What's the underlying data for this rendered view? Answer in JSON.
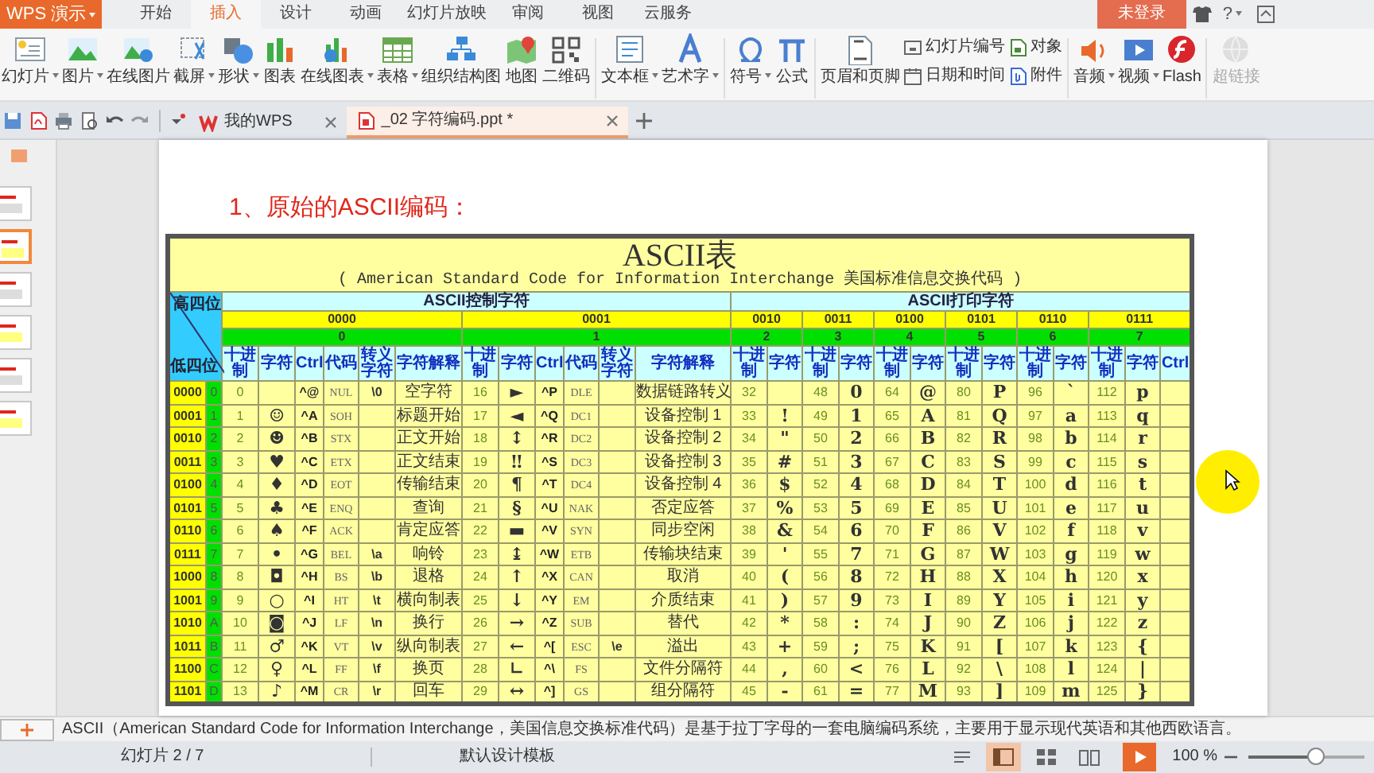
{
  "app_button": {
    "label": "WPS 演示"
  },
  "menu_tabs": [
    {
      "label": "开始",
      "selected": false
    },
    {
      "label": "插入",
      "selected": true
    },
    {
      "label": "设计",
      "selected": false
    },
    {
      "label": "动画",
      "selected": false
    },
    {
      "label": "幻灯片放映",
      "selected": false
    },
    {
      "label": "审阅",
      "selected": false
    },
    {
      "label": "视图",
      "selected": false
    },
    {
      "label": "云服务",
      "selected": false
    }
  ],
  "login_button": {
    "label": "未登录"
  },
  "help_button": {
    "label": "?"
  },
  "ribbon_groups": [
    [
      {
        "label": "幻灯片",
        "dropdown": true
      },
      {
        "label": "图片",
        "dropdown": true
      },
      {
        "label": "在线图片",
        "dropdown": false
      },
      {
        "label": "截屏",
        "dropdown": true
      },
      {
        "label": "形状",
        "dropdown": true
      },
      {
        "label": "图表",
        "dropdown": false
      },
      {
        "label": "在线图表",
        "dropdown": true
      },
      {
        "label": "表格",
        "dropdown": true
      },
      {
        "label": "组织结构图",
        "dropdown": false
      },
      {
        "label": "地图",
        "dropdown": false
      },
      {
        "label": "二维码",
        "dropdown": false
      }
    ],
    [
      {
        "label": "文本框",
        "dropdown": true
      },
      {
        "label": "艺术字",
        "dropdown": true
      }
    ],
    [
      {
        "label": "符号",
        "dropdown": true
      },
      {
        "label": "公式",
        "dropdown": false
      }
    ],
    [
      {
        "label": "页眉和页脚",
        "dropdown": false
      },
      {
        "kind": "stack",
        "items": [
          {
            "label": "幻灯片编号"
          },
          {
            "label": "日期和时间"
          }
        ]
      },
      {
        "kind": "stack",
        "items": [
          {
            "label": "对象"
          },
          {
            "label": "附件"
          }
        ]
      }
    ],
    [
      {
        "label": "音频",
        "dropdown": true
      },
      {
        "label": "视频",
        "dropdown": true
      },
      {
        "label": "Flash",
        "dropdown": false
      }
    ],
    [
      {
        "label": "超链接",
        "dropdown": false,
        "disabled": true
      }
    ]
  ],
  "doc_tabs": [
    {
      "label": "我的WPS",
      "selected": false
    },
    {
      "label": "_02 字符编码.ppt *",
      "selected": true
    }
  ],
  "thumbnails": [
    {
      "selected": false
    },
    {
      "selected": true
    },
    {
      "selected": false
    },
    {
      "selected": false
    },
    {
      "selected": false
    },
    {
      "selected": false
    }
  ],
  "slide": {
    "heading": "1、原始的ASCII编码：",
    "ascii_table": {
      "title": "ASCII表",
      "subtitle": "( American Standard Code for Information Interchange  美国标准信息交换代码 )",
      "corner_top": "高四位",
      "corner_bottom": "低四位",
      "sections": [
        {
          "label": "ASCII控制字符",
          "groups": [
            {
              "binary": "0000",
              "hex": "0",
              "columns": [
                "十进制",
                "字符",
                "Ctrl",
                "代码",
                "转义字符",
                "字符解释"
              ]
            },
            {
              "binary": "0001",
              "hex": "1",
              "columns": [
                "十进制",
                "字符",
                "Ctrl",
                "代码",
                "转义字符",
                "字符解释"
              ]
            }
          ]
        },
        {
          "label": "ASCII打印字符",
          "groups": [
            {
              "binary": "0010",
              "hex": "2",
              "columns": [
                "十进制",
                "字符"
              ]
            },
            {
              "binary": "0011",
              "hex": "3",
              "columns": [
                "十进制",
                "字符"
              ]
            },
            {
              "binary": "0100",
              "hex": "4",
              "columns": [
                "十进制",
                "字符"
              ]
            },
            {
              "binary": "0101",
              "hex": "5",
              "columns": [
                "十进制",
                "字符"
              ]
            },
            {
              "binary": "0110",
              "hex": "6",
              "columns": [
                "十进制",
                "字符"
              ]
            },
            {
              "binary": "0111",
              "hex": "7",
              "columns": [
                "十进制",
                "字符",
                "Ctrl"
              ]
            }
          ]
        }
      ],
      "rows": [
        {
          "binary": "0000",
          "hex": "0",
          "cells": [
            "0",
            null,
            "^@",
            "NUL",
            "\\0",
            "空字符",
            "16",
            "►",
            "^P",
            "DLE",
            null,
            "数据链路转义",
            "32",
            null,
            "48",
            "0",
            "64",
            "@",
            "80",
            "P",
            "96",
            "`",
            "112",
            "p",
            null
          ]
        },
        {
          "binary": "0001",
          "hex": "1",
          "cells": [
            "1",
            "☺",
            "^A",
            "SOH",
            null,
            "标题开始",
            "17",
            "◄",
            "^Q",
            "DC1",
            null,
            "设备控制 1",
            "33",
            "!",
            "49",
            "1",
            "65",
            "A",
            "81",
            "Q",
            "97",
            "a",
            "113",
            "q",
            null
          ]
        },
        {
          "binary": "0010",
          "hex": "2",
          "cells": [
            "2",
            "☻",
            "^B",
            "STX",
            null,
            "正文开始",
            "18",
            "↕",
            "^R",
            "DC2",
            null,
            "设备控制 2",
            "34",
            "\"",
            "50",
            "2",
            "66",
            "B",
            "82",
            "R",
            "98",
            "b",
            "114",
            "r",
            null
          ]
        },
        {
          "binary": "0011",
          "hex": "3",
          "cells": [
            "3",
            "♥",
            "^C",
            "ETX",
            null,
            "正文结束",
            "19",
            "‼",
            "^S",
            "DC3",
            null,
            "设备控制 3",
            "35",
            "#",
            "51",
            "3",
            "67",
            "C",
            "83",
            "S",
            "99",
            "c",
            "115",
            "s",
            null
          ]
        },
        {
          "binary": "0100",
          "hex": "4",
          "cells": [
            "4",
            "♦",
            "^D",
            "EOT",
            null,
            "传输结束",
            "20",
            "¶",
            "^T",
            "DC4",
            null,
            "设备控制 4",
            "36",
            "$",
            "52",
            "4",
            "68",
            "D",
            "84",
            "T",
            "100",
            "d",
            "116",
            "t",
            null
          ]
        },
        {
          "binary": "0101",
          "hex": "5",
          "cells": [
            "5",
            "♣",
            "^E",
            "ENQ",
            null,
            "查询",
            "21",
            "§",
            "^U",
            "NAK",
            null,
            "否定应答",
            "37",
            "%",
            "53",
            "5",
            "69",
            "E",
            "85",
            "U",
            "101",
            "e",
            "117",
            "u",
            null
          ]
        },
        {
          "binary": "0110",
          "hex": "6",
          "cells": [
            "6",
            "♠",
            "^F",
            "ACK",
            null,
            "肯定应答",
            "22",
            "▬",
            "^V",
            "SYN",
            null,
            "同步空闲",
            "38",
            "&",
            "54",
            "6",
            "70",
            "F",
            "86",
            "V",
            "102",
            "f",
            "118",
            "v",
            null
          ]
        },
        {
          "binary": "0111",
          "hex": "7",
          "cells": [
            "7",
            "•",
            "^G",
            "BEL",
            "\\a",
            "响铃",
            "23",
            "↨",
            "^W",
            "ETB",
            null,
            "传输块结束",
            "39",
            "'",
            "55",
            "7",
            "71",
            "G",
            "87",
            "W",
            "103",
            "g",
            "119",
            "w",
            null
          ]
        },
        {
          "binary": "1000",
          "hex": "8",
          "cells": [
            "8",
            "◘",
            "^H",
            "BS",
            "\\b",
            "退格",
            "24",
            "↑",
            "^X",
            "CAN",
            null,
            "取消",
            "40",
            "(",
            "56",
            "8",
            "72",
            "H",
            "88",
            "X",
            "104",
            "h",
            "120",
            "x",
            null
          ]
        },
        {
          "binary": "1001",
          "hex": "9",
          "cells": [
            "9",
            "○",
            "^I",
            "HT",
            "\\t",
            "横向制表",
            "25",
            "↓",
            "^Y",
            "EM",
            null,
            "介质结束",
            "41",
            ")",
            "57",
            "9",
            "73",
            "I",
            "89",
            "Y",
            "105",
            "i",
            "121",
            "y",
            null
          ]
        },
        {
          "binary": "1010",
          "hex": "A",
          "cells": [
            "10",
            "◙",
            "^J",
            "LF",
            "\\n",
            "换行",
            "26",
            "→",
            "^Z",
            "SUB",
            null,
            "替代",
            "42",
            "*",
            "58",
            ":",
            "74",
            "J",
            "90",
            "Z",
            "106",
            "j",
            "122",
            "z",
            null
          ]
        },
        {
          "binary": "1011",
          "hex": "B",
          "cells": [
            "11",
            "♂",
            "^K",
            "VT",
            "\\v",
            "纵向制表",
            "27",
            "←",
            "^[",
            "ESC",
            "\\e",
            "溢出",
            "43",
            "+",
            "59",
            ";",
            "75",
            "K",
            "91",
            "[",
            "107",
            "k",
            "123",
            "{",
            null
          ]
        },
        {
          "binary": "1100",
          "hex": "C",
          "cells": [
            "12",
            "♀",
            "^L",
            "FF",
            "\\f",
            "换页",
            "28",
            "∟",
            "^\\",
            "FS",
            null,
            "文件分隔符",
            "44",
            ",",
            "60",
            "<",
            "76",
            "L",
            "92",
            "\\",
            "108",
            "l",
            "124",
            "|",
            null
          ]
        },
        {
          "binary": "1101",
          "hex": "D",
          "cells": [
            "13",
            "♪",
            "^M",
            "CR",
            "\\r",
            "回车",
            "29",
            "↔",
            "^]",
            "GS",
            null,
            "组分隔符",
            "45",
            "-",
            "61",
            "=",
            "77",
            "M",
            "93",
            "]",
            "109",
            "m",
            "125",
            "}",
            null
          ]
        }
      ]
    }
  },
  "notes": "ASCII（American Standard Code for Information Interchange，美国信息交换标准代码）是基于拉丁字母的一套电脑编码系统，主要用于显示现代英语和其他西欧语言。",
  "status_bar": {
    "slide_counter": "幻灯片 2 / 7",
    "template": "默认设计模板",
    "views": [
      {
        "selected": true
      },
      {
        "selected": false
      },
      {
        "selected": false
      }
    ],
    "zoom": "100 %",
    "zoom_slider": {
      "level": 0.57
    }
  }
}
